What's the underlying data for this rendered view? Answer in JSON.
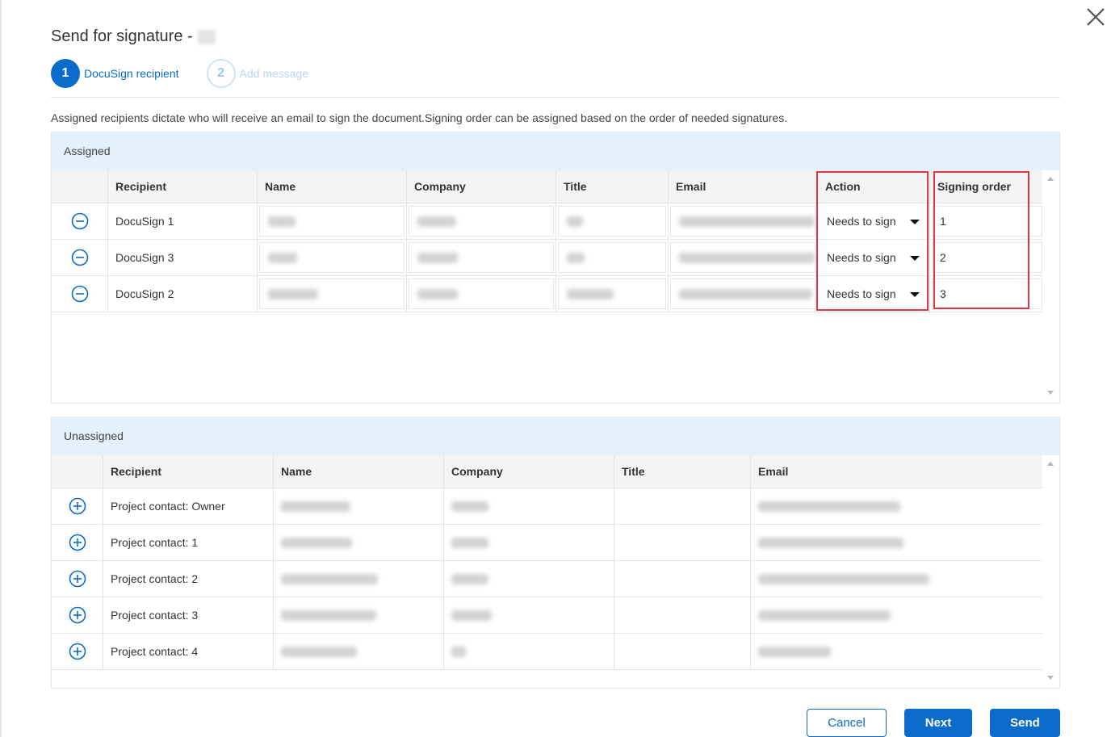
{
  "dialog": {
    "title": "Send for signature -",
    "close_icon": "close-icon"
  },
  "stepper": {
    "steps": [
      {
        "number": "1",
        "label": "DocuSign recipient",
        "state": "active"
      },
      {
        "number": "2",
        "label": "Add message",
        "state": "inactive"
      }
    ]
  },
  "description": "Assigned recipients dictate who will receive an email to sign the document.Signing order can be assigned based on the order of needed signatures.",
  "assigned": {
    "heading": "Assigned",
    "columns": [
      "Recipient",
      "Name",
      "Company",
      "Title",
      "Email",
      "Action",
      "Signing order"
    ],
    "rows": [
      {
        "recipient": "DocuSign 1",
        "action": "Needs to sign",
        "signing_order": "1"
      },
      {
        "recipient": "DocuSign 3",
        "action": "Needs to sign",
        "signing_order": "2"
      },
      {
        "recipient": "DocuSign 2",
        "action": "Needs to sign",
        "signing_order": "3"
      }
    ],
    "row_icon": "minus-circle-icon"
  },
  "unassigned": {
    "heading": "Unassigned",
    "columns": [
      "Recipient",
      "Name",
      "Company",
      "Title",
      "Email"
    ],
    "rows": [
      {
        "recipient": "Project contact: Owner"
      },
      {
        "recipient": "Project contact: 1"
      },
      {
        "recipient": "Project contact: 2"
      },
      {
        "recipient": "Project contact: 3"
      },
      {
        "recipient": "Project contact: 4"
      }
    ],
    "row_icon": "plus-circle-icon"
  },
  "footer": {
    "cancel_label": "Cancel",
    "next_label": "Next",
    "send_label": "Send"
  },
  "colors": {
    "primary": "#0b6bcb",
    "panel_header": "#e5f1fa",
    "highlight": "#e2353f"
  }
}
